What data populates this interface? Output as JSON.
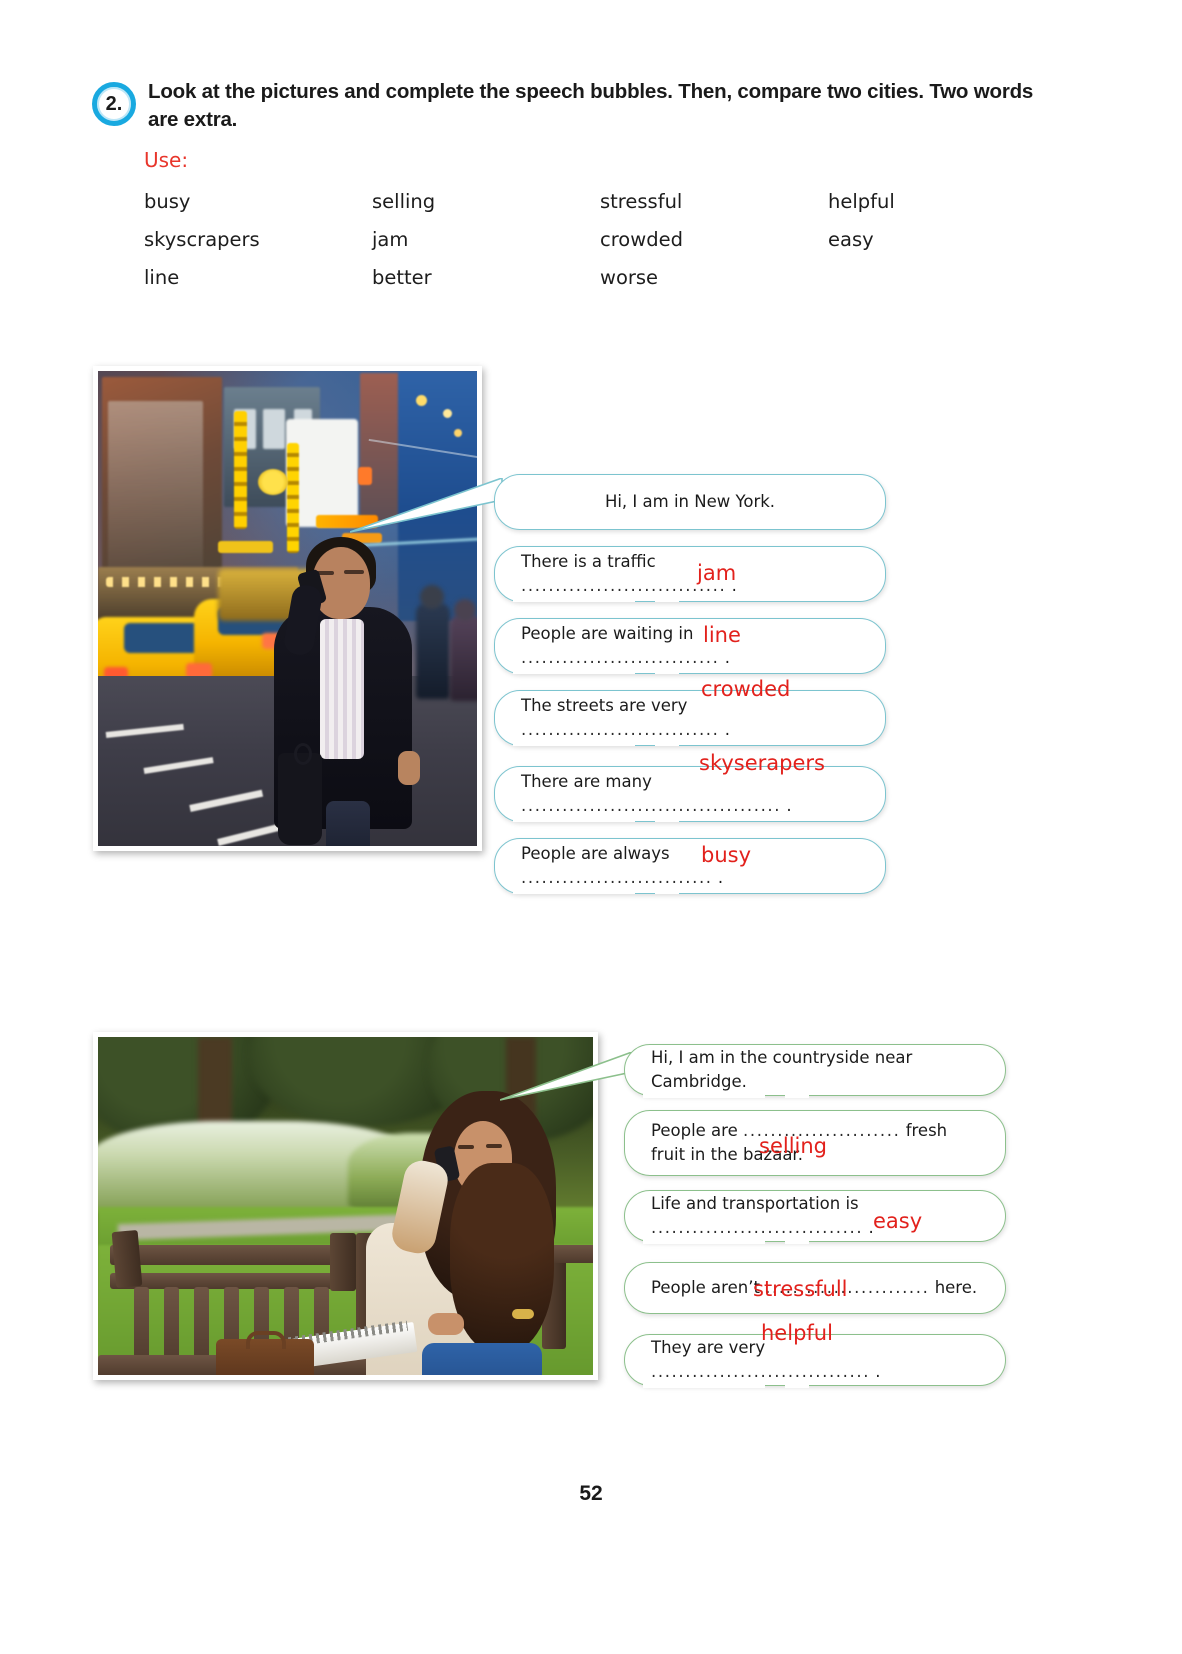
{
  "exercise": {
    "number": "2.",
    "instruction": "Look at the pictures and complete the speech bubbles. Then, compare two cities. Two words are extra.",
    "use_label": "Use:"
  },
  "word_bank": {
    "rows": [
      [
        "busy",
        "selling",
        "stressful",
        "helpful"
      ],
      [
        "skyscrapers",
        "jam",
        "crowded",
        "easy"
      ],
      [
        "line",
        "better",
        "worse",
        ""
      ]
    ]
  },
  "city_block": {
    "photo_alt": "man-on-phone-times-square-photo",
    "border_color": "#7cc4cf",
    "bubbles": [
      {
        "id": "bubble-new-york-greeting",
        "pre": "Hi, I am in New York.",
        "dots": "",
        "post": "",
        "answer": ""
      },
      {
        "id": "bubble-traffic-jam",
        "pre": "There is a traffic",
        "dots": "..............................",
        "post": ".",
        "answer": "jam"
      },
      {
        "id": "bubble-waiting-in-line",
        "pre": "People are waiting in",
        "dots": ".............................",
        "post": ".",
        "answer": "line"
      },
      {
        "id": "bubble-streets-crowded",
        "pre": "The streets are very",
        "dots": ".............................",
        "post": ".",
        "answer": "crowded"
      },
      {
        "id": "bubble-many-skyscrapers",
        "pre": "There are many",
        "dots": "......................................",
        "post": ".",
        "answer": "skyserapers"
      },
      {
        "id": "bubble-people-busy",
        "pre": "People are always",
        "dots": "............................",
        "post": ".",
        "answer": "busy"
      }
    ]
  },
  "country_block": {
    "photo_alt": "woman-on-phone-park-bench-photo",
    "border_color": "#8cc08c",
    "bubbles": [
      {
        "id": "bubble-cambridge-greeting",
        "pre": "Hi, I am in the countryside near Cambridge.",
        "dots": "",
        "post": "",
        "answer": ""
      },
      {
        "id": "bubble-selling-fruit",
        "pre": "People are",
        "dots": ".......................",
        "post": "fresh fruit in the bazaar.",
        "answer": "selling"
      },
      {
        "id": "bubble-transportation-easy",
        "pre": "Life and transportation is",
        "dots": "...............................",
        "post": ".",
        "answer": "easy"
      },
      {
        "id": "bubble-not-stressful",
        "pre": "People aren’t",
        "dots": "........................",
        "post": "here.",
        "answer": "stressfull"
      },
      {
        "id": "bubble-very-helpful",
        "pre": "They are very",
        "dots": "................................",
        "post": ".",
        "answer": "helpful"
      }
    ]
  },
  "footer": {
    "page_number": "52"
  },
  "colors": {
    "badge_ring": "#19a9e0",
    "answer_red": "#e2211c",
    "use_red": "#e8352b",
    "city_bubble_border": "#7cc4cf",
    "country_bubble_border": "#8cc08c"
  }
}
